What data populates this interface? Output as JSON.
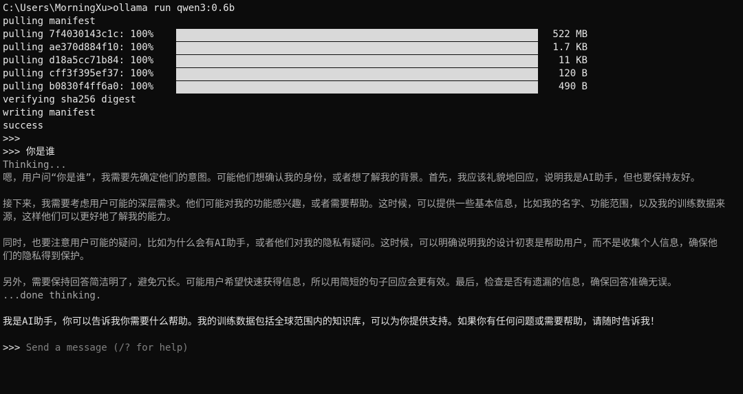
{
  "terminal": {
    "command_line": "C:\\Users\\MorningXu>ollama run qwen3:0.6b",
    "pulling_manifest": "pulling manifest",
    "pulls": [
      {
        "label": "pulling 7f4030143c1c: 100%",
        "size": "522 MB",
        "progress": 100
      },
      {
        "label": "pulling ae370d884f10: 100%",
        "size": "1.7 KB",
        "progress": 100
      },
      {
        "label": "pulling d18a5cc71b84: 100%",
        "size": "11 KB",
        "progress": 100
      },
      {
        "label": "pulling cff3f395ef37: 100%",
        "size": "120 B",
        "progress": 100
      },
      {
        "label": "pulling b0830f4ff6a0: 100%",
        "size": "490 B",
        "progress": 100
      }
    ],
    "verifying": "verifying sha256 digest",
    "writing": "writing manifest",
    "success": "success",
    "empty_prompt": ">>>",
    "user_prompt": ">>> 你是谁",
    "thinking_start": "Thinking...",
    "thinking_paragraphs": [
      "嗯，用户问“你是谁”，我需要先确定他们的意图。可能他们想确认我的身份，或者想了解我的背景。首先，我应该礼貌地回应，说明我是AI助手，但也要保持友好。",
      "接下来，我需要考虑用户可能的深层需求。他们可能对我的功能感兴趣，或者需要帮助。这时候，可以提供一些基本信息，比如我的名字、功能范围，以及我的训练数据来源，这样他们可以更好地了解我的能力。",
      "同时，也要注意用户可能的疑问，比如为什么会有AI助手，或者他们对我的隐私有疑问。这时候，可以明确说明我的设计初衷是帮助用户，而不是收集个人信息，确保他们的隐私得到保护。",
      "另外，需要保持回答简洁明了，避免冗长。可能用户希望快速获得信息，所以用简短的句子回应会更有效。最后，检查是否有遗漏的信息，确保回答准确无误。"
    ],
    "thinking_end": "...done thinking.",
    "response": "我是AI助手，你可以告诉我你需要什么帮助。我的训练数据包括全球范围内的知识库，可以为你提供支持。如果你有任何问题或需要帮助，请随时告诉我！",
    "input_prompt": ">>> ",
    "input_placeholder": "Send a message (/? for help)"
  },
  "colors": {
    "background": "#0c0c0c",
    "text": "#cccccc",
    "progress_bar": "#d9d9d9"
  }
}
